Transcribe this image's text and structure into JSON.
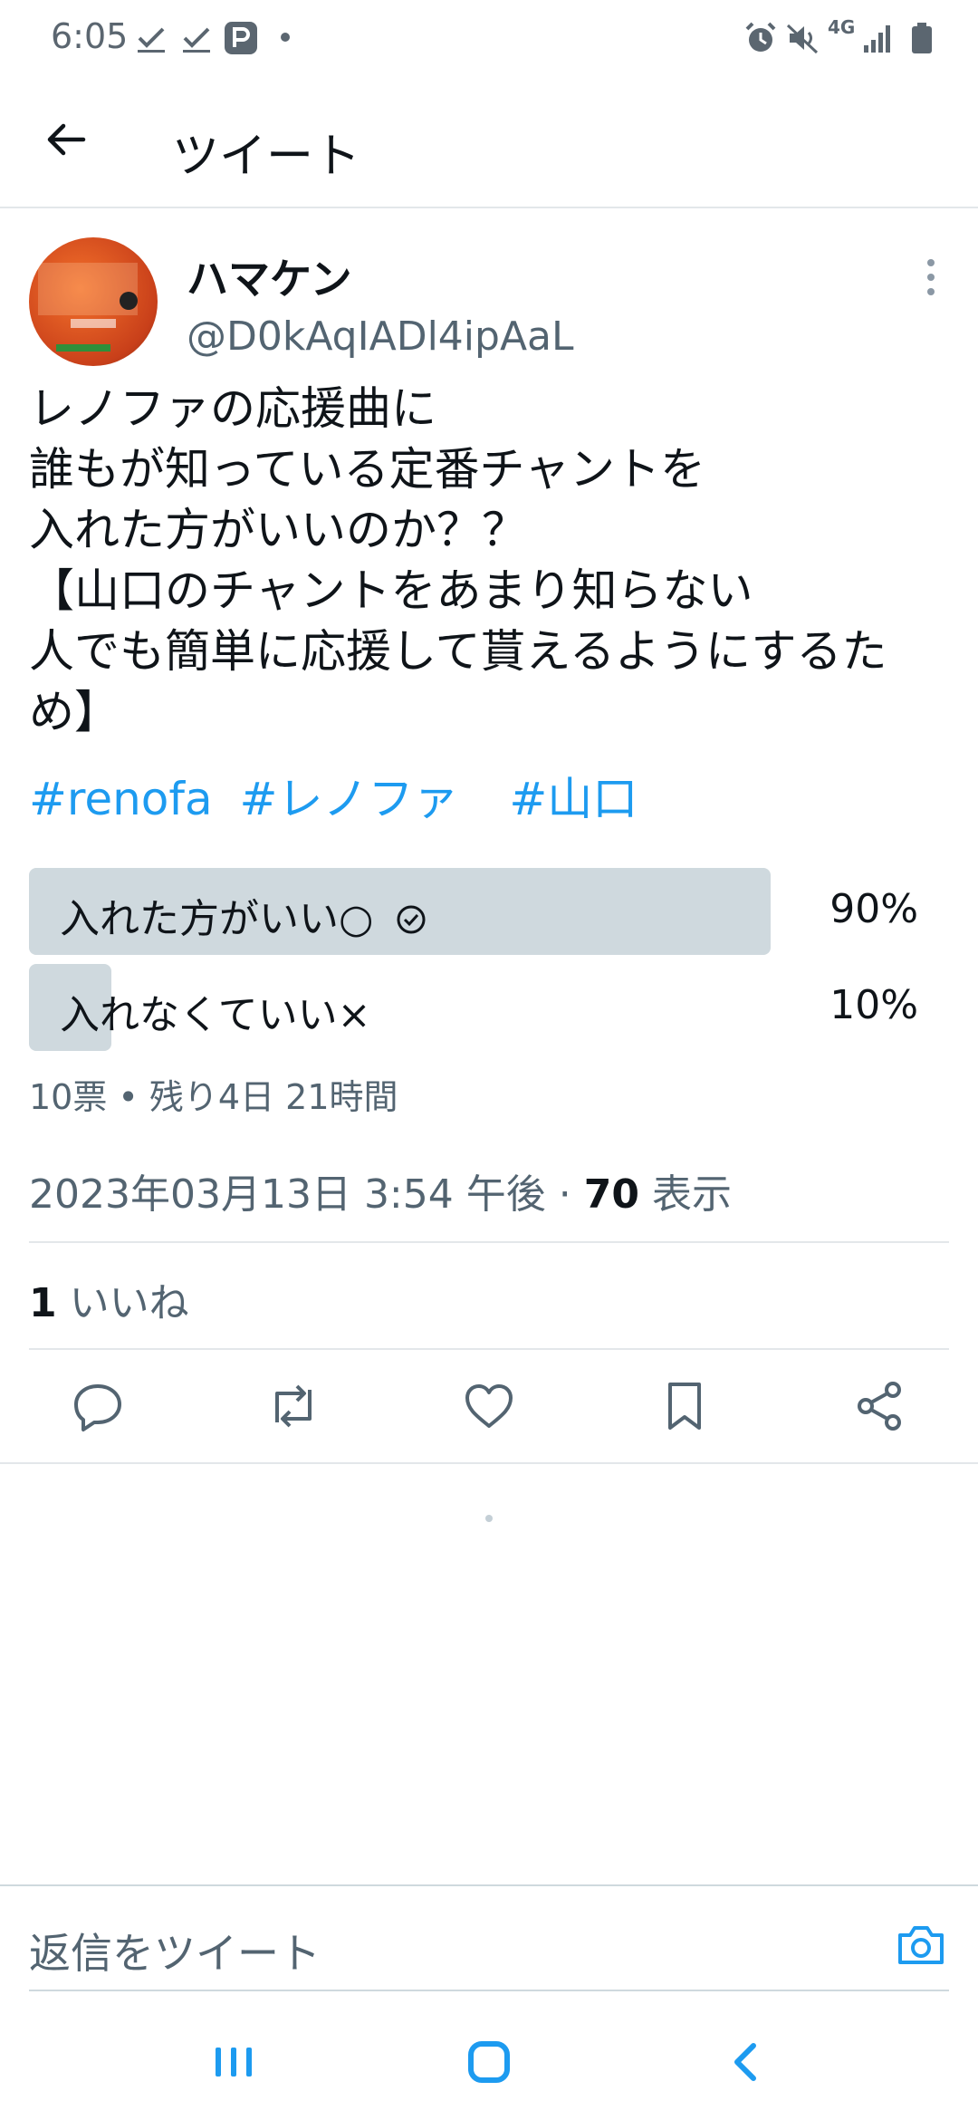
{
  "status_bar": {
    "time": "6:05",
    "network": "4G"
  },
  "header": {
    "title": "ツイート"
  },
  "tweet": {
    "display_name": "ハマケン",
    "handle": "@D0kAqIADl4ipAaL",
    "text_lines": [
      "レノファの応援曲に",
      "誰もが知っている定番チャントを",
      "入れた方がいいのか？？",
      "【山口のチャントをあまり知らない",
      "人でも簡単に応援して貰えるようにするた",
      "め】"
    ],
    "hashtags": [
      "#renofa",
      "#レノファ",
      "#山口"
    ],
    "poll": {
      "options": [
        {
          "label": "入れた方がいい○",
          "percent_text": "90%",
          "percent": 90,
          "chosen": true
        },
        {
          "label": "入れなくていい×",
          "percent_text": "10%",
          "percent": 10,
          "chosen": false
        }
      ],
      "meta": "10票 • 残り4日 21時間"
    },
    "timestamp": "2023年03月13日 3:54 午後",
    "views_count": "70",
    "views_label": "表示",
    "likes_count": "1",
    "likes_label": "いいね"
  },
  "reply": {
    "placeholder": "返信をツイート"
  },
  "colors": {
    "accent": "#1d9bf0",
    "poll_fill": "#cfd9de",
    "secondary_text": "#536471"
  },
  "icons": {
    "back": "arrow-left-icon",
    "more": "more-vertical-icon",
    "reply": "comment-icon",
    "retweet": "retweet-icon",
    "like": "heart-icon",
    "bookmark": "bookmark-icon",
    "share": "share-icon",
    "camera": "camera-icon"
  }
}
